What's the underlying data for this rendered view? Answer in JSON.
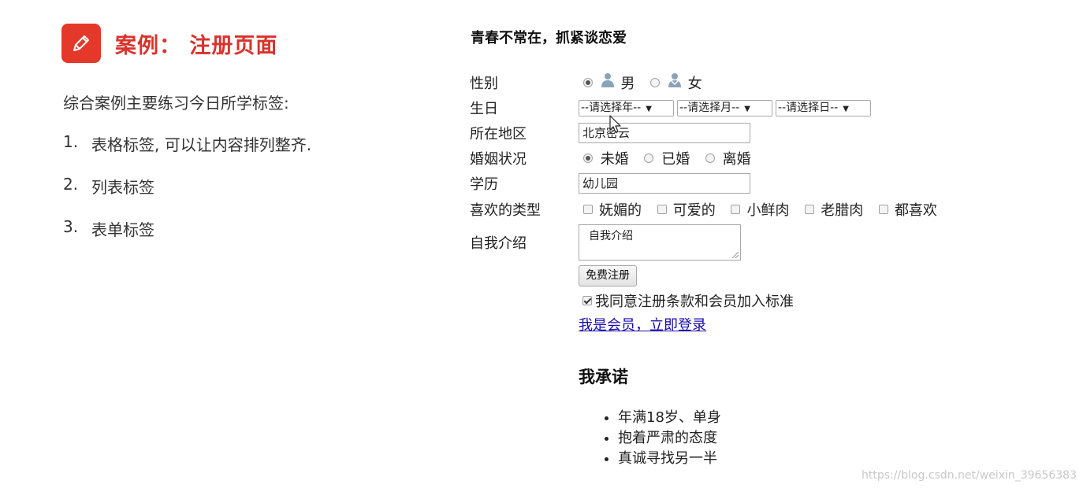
{
  "slide": {
    "title": "案例： 注册页面",
    "intro": "综合案例主要练习今日所学标签:",
    "points": [
      {
        "num": "1.",
        "text": "表格标签, 可以让内容排列整齐."
      },
      {
        "num": "2.",
        "text": "列表标签"
      },
      {
        "num": "3.",
        "text": "表单标签"
      }
    ]
  },
  "form": {
    "heading": "青春不常在，抓紧谈恋爱",
    "gender": {
      "label": "性别",
      "male": "男",
      "female": "女",
      "selected": "male"
    },
    "birthday": {
      "label": "生日",
      "year": "--请选择年--",
      "month": "--请选择月--",
      "day": "--请选择日--"
    },
    "area": {
      "label": "所在地区",
      "value": "北京密云"
    },
    "marital": {
      "label": "婚姻状况",
      "options": [
        "未婚",
        "已婚",
        "离婚"
      ],
      "selected": "未婚"
    },
    "education": {
      "label": "学历",
      "value": "幼儿园"
    },
    "preference": {
      "label": "喜欢的类型",
      "options": [
        "妩媚的",
        "可爱的",
        "小鲜肉",
        "老腊肉",
        "都喜欢"
      ]
    },
    "self_intro": {
      "label": "自我介绍",
      "value": "自我介绍"
    },
    "submit_label": "免费注册",
    "agree_label": "我同意注册条款和会员加入标准",
    "login_link": "我是会员，立即登录"
  },
  "promise": {
    "title": "我承诺",
    "items": [
      "年满18岁、单身",
      "抱着严肃的态度",
      "真诚寻找另一半"
    ]
  },
  "watermark": "https://blog.csdn.net/weixin_39656383",
  "colors": {
    "accent": "#e4382a",
    "title": "#d9332c",
    "link": "#1a0dab"
  }
}
